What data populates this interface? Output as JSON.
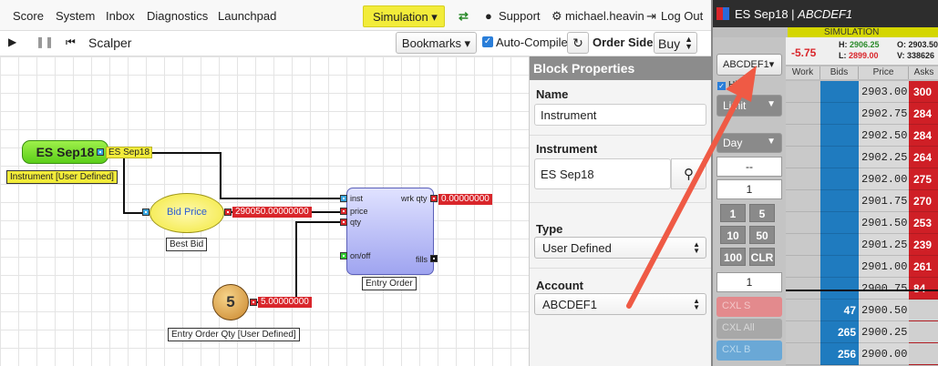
{
  "nav": {
    "items": [
      "Score",
      "System",
      "Inbox",
      "Diagnostics",
      "Launchpad"
    ],
    "simulation": "Simulation ▾",
    "support": "Support",
    "user": "michael.heavin",
    "logout": "Log Out"
  },
  "toolbar": {
    "strategy_name": "Scalper",
    "bookmarks": "Bookmarks ▾",
    "auto_compile": "Auto-Compile",
    "order_side_label": "Order Side",
    "order_side_value": "Buy"
  },
  "canvas": {
    "instrument_block": "ES Sep18",
    "instrument_output": "ES Sep18",
    "instrument_label": "Instrument [User Defined]",
    "bid_block": "Bid Price",
    "bid_label": "Best Bid",
    "bid_value": "290050.00000000",
    "qty_block": "5",
    "qty_value": "5.00000000",
    "qty_label": "Entry Order Qty [User Defined]",
    "order_inputs": [
      "inst",
      "price",
      "qty",
      "on/off"
    ],
    "order_outputs": [
      "wrk qty",
      "fills"
    ],
    "wrk_qty_value": "0.00000000",
    "order_label": "Entry Order"
  },
  "properties": {
    "header": "Block Properties",
    "name_label": "Name",
    "name_value": "Instrument",
    "instrument_label": "Instrument",
    "instrument_value": "ES Sep18",
    "type_label": "Type",
    "type_value": "User Defined",
    "account_label": "Account",
    "account_value": "ABCDEF1"
  },
  "ladder": {
    "title": "ES Sep18 | ",
    "account_italic": "ABCDEF1",
    "simulation": "SIMULATION",
    "change": "-5.75",
    "h_label": "H: ",
    "h_value": "2906.25",
    "l_label": "L: ",
    "l_value": "2899.00",
    "o_label": "O: 2903.50",
    "v_label": "V: 338626",
    "account_btn": "ABCDEF1▾",
    "hit_label": "Hit",
    "limit_label": "Limit",
    "day_label": "Day",
    "dash_field": "--",
    "qty_field1": "1",
    "qty_field2": "1",
    "qty_buttons": [
      "1",
      "5",
      "10",
      "50",
      "100",
      "CLR"
    ],
    "cxl_buttons": [
      "CXL S",
      "CXL All",
      "CXL B"
    ],
    "col_work": "Work",
    "col_bids": "Bids",
    "col_price": "Price",
    "col_asks": "Asks",
    "rows": [
      {
        "bids": "",
        "price": "2903.00",
        "asks": "300"
      },
      {
        "bids": "",
        "price": "2902.75",
        "asks": "284"
      },
      {
        "bids": "",
        "price": "2902.50",
        "asks": "284"
      },
      {
        "bids": "",
        "price": "2902.25",
        "asks": "264"
      },
      {
        "bids": "",
        "price": "2902.00",
        "asks": "275"
      },
      {
        "bids": "",
        "price": "2901.75",
        "asks": "270"
      },
      {
        "bids": "",
        "price": "2901.50",
        "asks": "253"
      },
      {
        "bids": "",
        "price": "2901.25",
        "asks": "239"
      },
      {
        "bids": "",
        "price": "2901.00",
        "asks": "261"
      },
      {
        "bids": "",
        "price": "2900.75",
        "asks": "84"
      },
      {
        "bids": "47",
        "price": "2900.50",
        "asks": ""
      },
      {
        "bids": "265",
        "price": "2900.25",
        "asks": ""
      },
      {
        "bids": "256",
        "price": "2900.00",
        "asks": ""
      }
    ]
  }
}
